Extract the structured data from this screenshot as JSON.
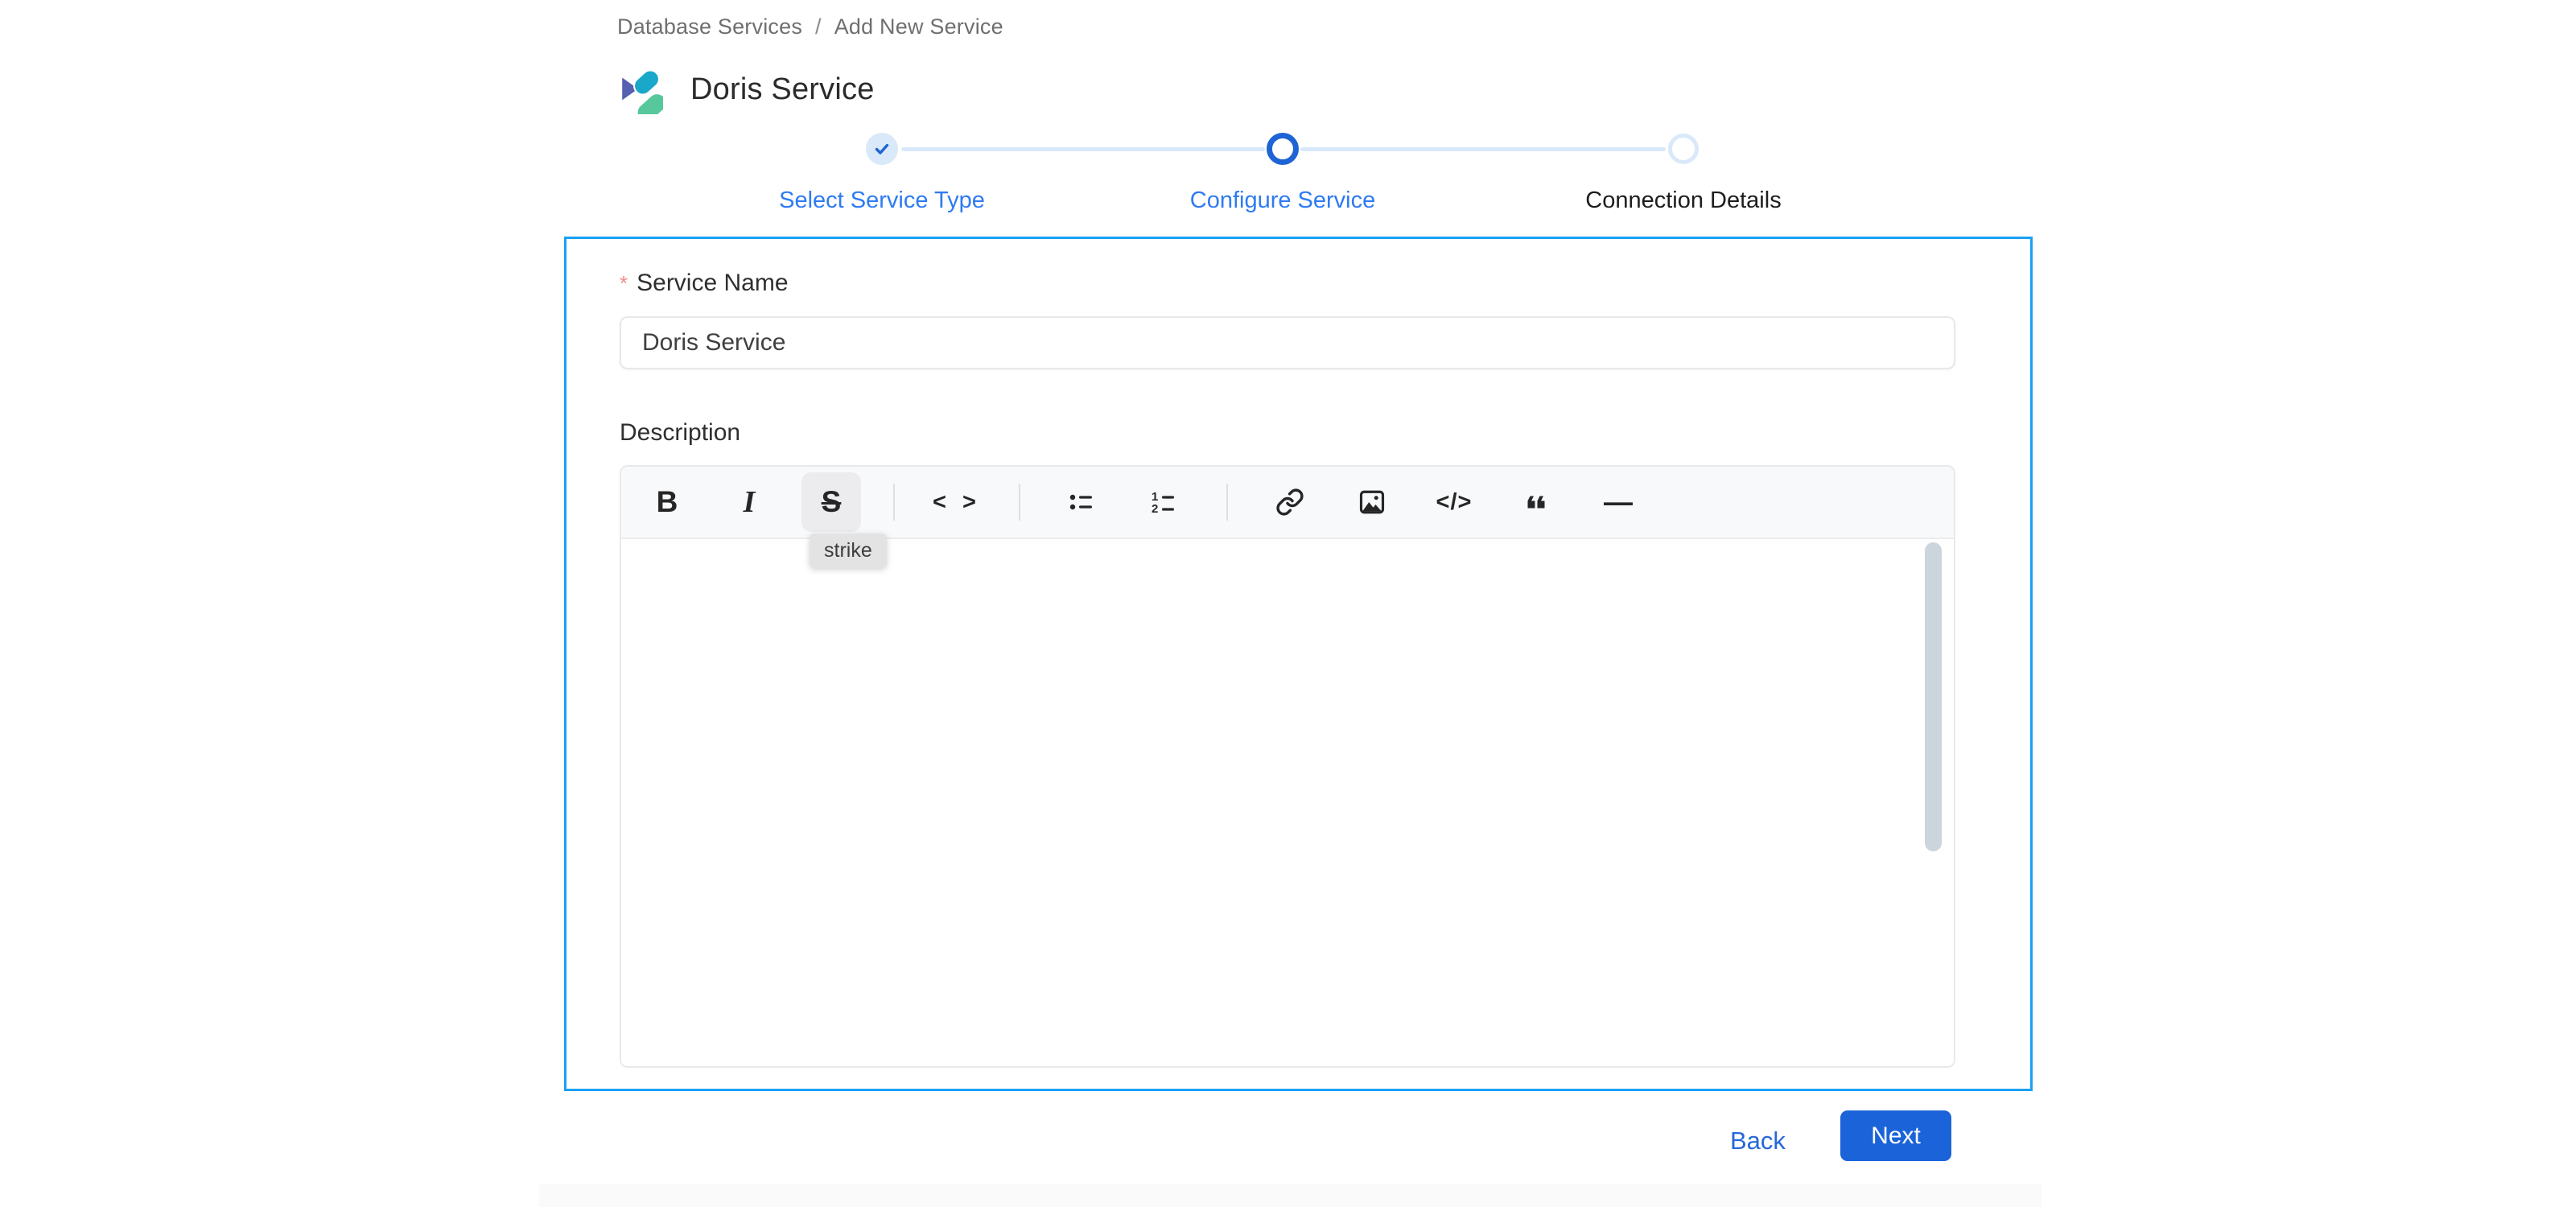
{
  "breadcrumb": {
    "items": [
      {
        "label": "Database Services"
      },
      {
        "label": "Add New Service"
      }
    ],
    "separator": "/"
  },
  "header": {
    "title": "Doris Service",
    "logo": "doris-logo"
  },
  "stepper": {
    "steps": [
      {
        "label": "Select Service Type",
        "state": "completed"
      },
      {
        "label": "Configure Service",
        "state": "active"
      },
      {
        "label": "Connection Details",
        "state": "upcoming"
      }
    ]
  },
  "form": {
    "service_name": {
      "required_marker": "*",
      "label": "Service Name",
      "value": "Doris Service"
    },
    "description": {
      "label": "Description",
      "content": ""
    }
  },
  "editor": {
    "toolbar": {
      "buttons": [
        {
          "name": "bold",
          "glyph": "B"
        },
        {
          "name": "italic",
          "glyph": "I"
        },
        {
          "name": "strike",
          "glyph": "S",
          "active": true,
          "tooltip": "strike"
        },
        {
          "name": "inline-code",
          "glyph": "< >"
        },
        {
          "name": "bullet-list"
        },
        {
          "name": "ordered-list",
          "rows": [
            "1",
            "2"
          ]
        },
        {
          "name": "link"
        },
        {
          "name": "image"
        },
        {
          "name": "code-block",
          "glyph": "</>"
        },
        {
          "name": "blockquote"
        },
        {
          "name": "horizontal-rule",
          "glyph": "—"
        }
      ]
    }
  },
  "actions": {
    "back_label": "Back",
    "next_label": "Next"
  },
  "colors": {
    "accent": "#1f64d4",
    "step_label_blue": "#2e7bf2",
    "step_light_blue": "#d9e9fa",
    "card_border": "#1aa0f5",
    "next_button": "#1b63d8",
    "back_link": "#2767d9",
    "toolbar_bg": "#f8f9fb",
    "scrollbar_thumb": "#ccd5db",
    "required_marker": "#f08a8a",
    "tooltip_bg": "#e3e3e3"
  }
}
